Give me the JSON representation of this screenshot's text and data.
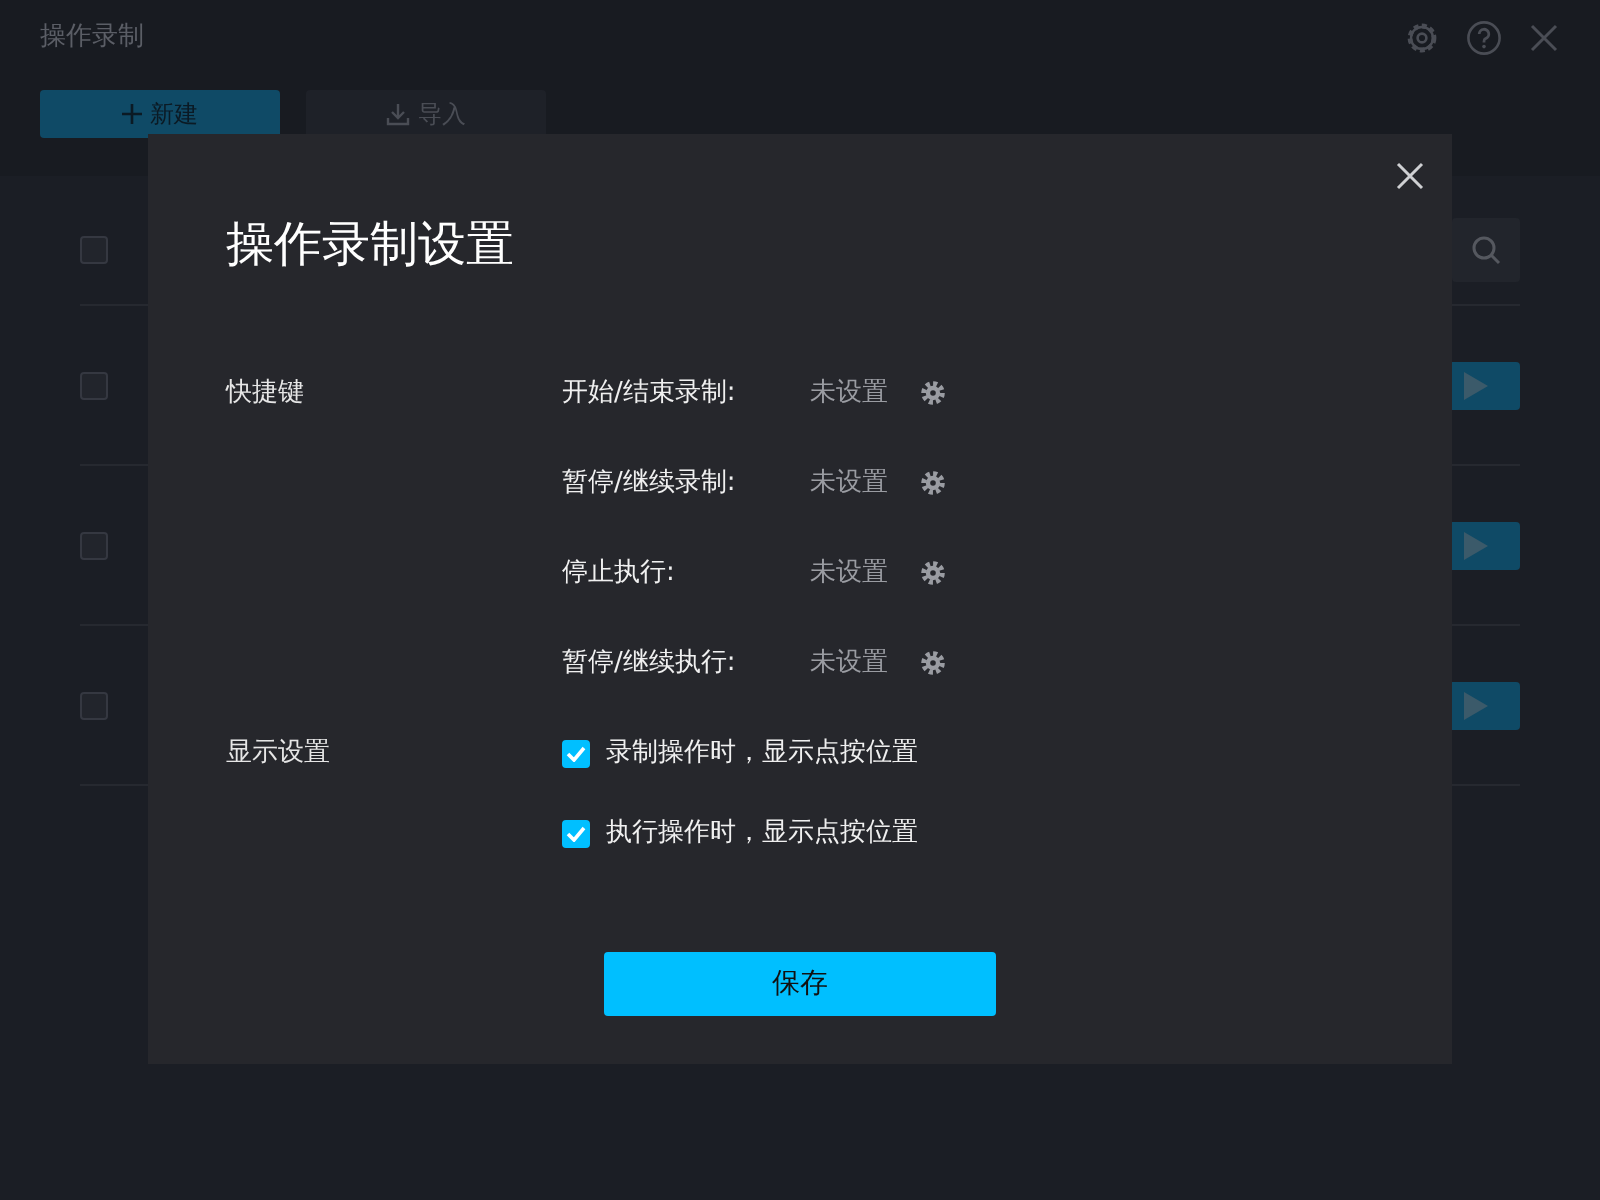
{
  "app": {
    "title": "操作录制",
    "buttons": [
      {
        "label": "新建",
        "kind": "primary"
      },
      {
        "label": "导入",
        "kind": "secondary"
      }
    ],
    "rows": [
      {
        "checked": false
      },
      {
        "checked": false
      },
      {
        "checked": false
      },
      {
        "checked": false
      }
    ]
  },
  "dialog": {
    "title": "操作录制设置",
    "shortcuts": {
      "label": "快捷键",
      "items": [
        {
          "label": "开始/结束录制:",
          "value": "未设置"
        },
        {
          "label": "暂停/继续录制:",
          "value": "未设置"
        },
        {
          "label": "停止执行:",
          "value": "未设置"
        },
        {
          "label": "暂停/继续执行:",
          "value": "未设置"
        }
      ]
    },
    "display": {
      "label": "显示设置",
      "options": [
        {
          "label": "录制操作时，显示点按位置",
          "checked": true
        },
        {
          "label": "执行操作时，显示点按位置",
          "checked": true
        }
      ]
    },
    "save_button": "保存"
  }
}
